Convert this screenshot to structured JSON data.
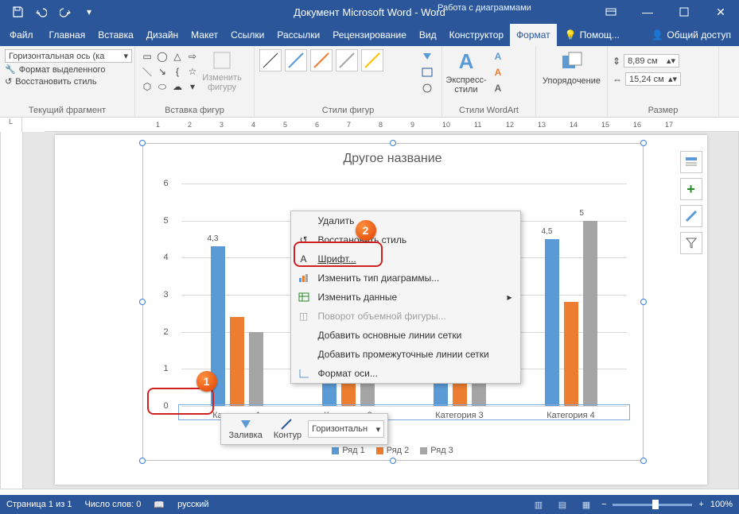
{
  "title": "Документ Microsoft Word - Word",
  "context_title": "Работа с диаграммами",
  "tabs": [
    "Файл",
    "Главная",
    "Вставка",
    "Дизайн",
    "Макет",
    "Ссылки",
    "Рассылки",
    "Рецензирование",
    "Вид",
    "Конструктор",
    "Формат"
  ],
  "active_tab": 10,
  "help": "Помощ...",
  "share": "Общий доступ",
  "ribbon": {
    "g1": {
      "combo": "Горизонтальная ось (ка",
      "fmt_sel": "Формат выделенного",
      "reset": "Восстановить стиль",
      "label": "Текущий фрагмент"
    },
    "g2": {
      "change": "Изменить фигуру",
      "label": "Вставка фигур"
    },
    "g3": {
      "label": "Стили фигур"
    },
    "g4": {
      "express": "Экспресс-стили",
      "label": "Стили WordArt"
    },
    "g5": {
      "arrange": "Упорядочение"
    },
    "g6": {
      "h": "8,89 см",
      "w": "15,24 см",
      "label": "Размер"
    }
  },
  "chart_data": {
    "type": "bar",
    "title": "Другое название",
    "categories": [
      "Категория 1",
      "Категория 2",
      "Категория 3",
      "Категория 4"
    ],
    "series": [
      {
        "name": "Ряд 1",
        "values": [
          4.3,
          2.5,
          3.5,
          4.5
        ],
        "color": "#5b9bd5"
      },
      {
        "name": "Ряд 2",
        "values": [
          2.4,
          4.4,
          1.8,
          2.8
        ],
        "color": "#ed7d31"
      },
      {
        "name": "Ряд 3",
        "values": [
          2.0,
          2.0,
          3.0,
          5.0
        ],
        "color": "#a5a5a5"
      }
    ],
    "labels_visible": [
      4.3,
      null,
      null,
      4.5,
      5
    ],
    "ylim": [
      0,
      6
    ],
    "yticks": [
      0,
      1,
      2,
      3,
      4,
      5,
      6
    ]
  },
  "legend": [
    "Ряд 1",
    "Ряд 2",
    "Ряд 3"
  ],
  "ctx": {
    "delete": "Удалить",
    "reset": "Восстановить стиль",
    "font": "Шрифт...",
    "chg_type": "Изменить тип диаграммы...",
    "chg_data": "Изменить данные",
    "rotate": "Поворот объемной фигуры...",
    "major": "Добавить основные линии сетки",
    "minor": "Добавить промежуточные линии сетки",
    "axis_fmt": "Формат оси..."
  },
  "mini": {
    "fill": "Заливка",
    "outline": "Контур",
    "combo": "Горизонтальн"
  },
  "status": {
    "page": "Страница 1 из 1",
    "words": "Число слов: 0",
    "lang": "русский",
    "zoom": "100%"
  },
  "ruler_ticks": [
    1,
    2,
    3,
    4,
    5,
    6,
    7,
    8,
    9,
    10,
    11,
    12,
    13,
    14,
    15,
    16,
    17
  ]
}
